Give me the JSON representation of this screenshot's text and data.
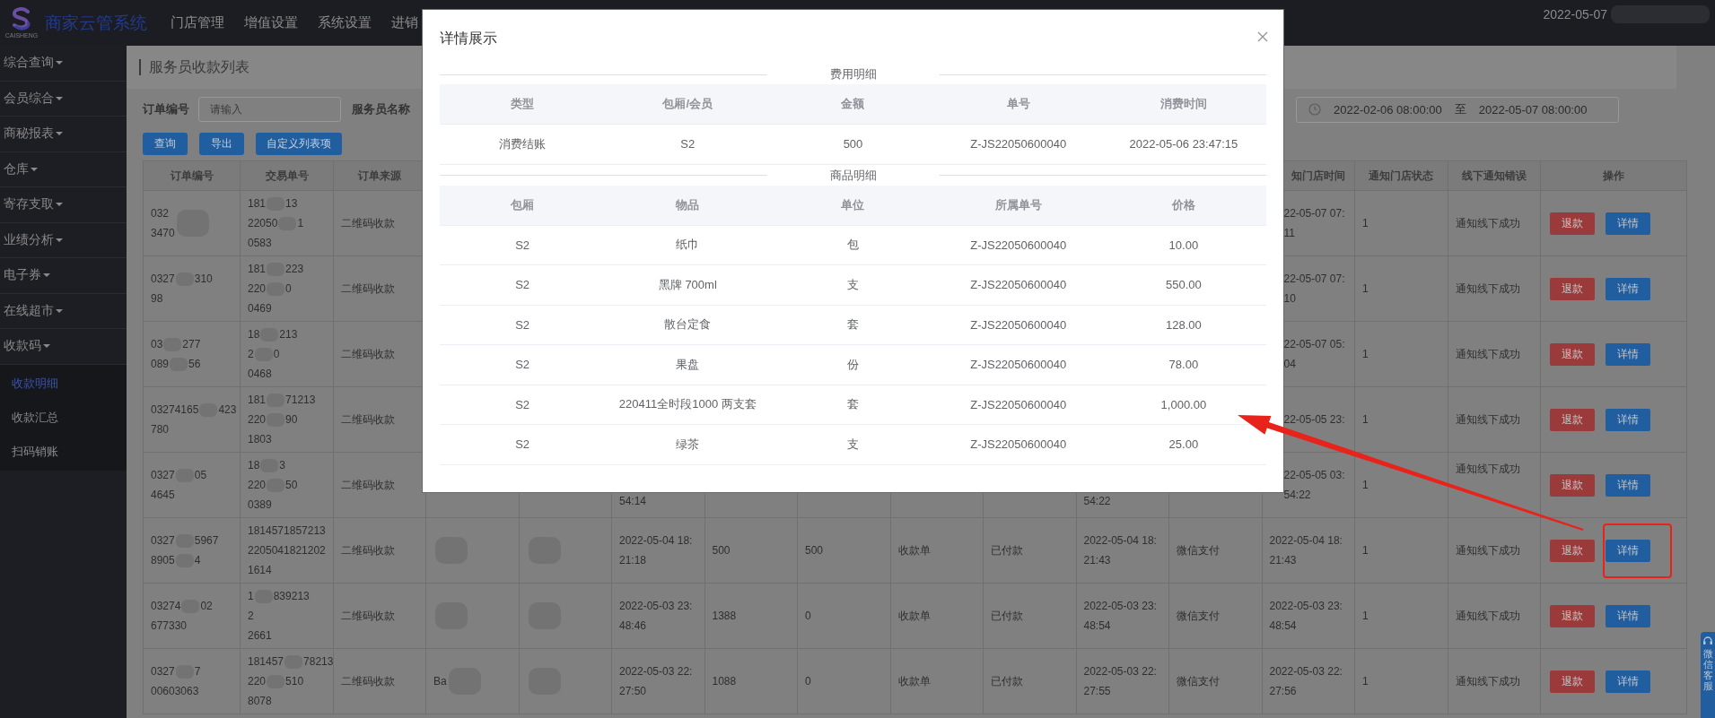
{
  "header": {
    "logo_text": "CAISHENG",
    "app_title": "商家云管系统",
    "nav": [
      "门店管理",
      "增值设置",
      "系统设置",
      "进销"
    ],
    "date": "2022-05-07"
  },
  "sidebar": {
    "items": [
      {
        "label": "综合查询"
      },
      {
        "label": "会员综合"
      },
      {
        "label": "商秘报表"
      },
      {
        "label": "仓库"
      },
      {
        "label": "寄存支取"
      },
      {
        "label": "业绩分析"
      },
      {
        "label": "电子券"
      },
      {
        "label": "在线超市"
      },
      {
        "label": "收款码",
        "children": [
          {
            "label": "收款明细",
            "selected": true
          },
          {
            "label": "收款汇总",
            "selected": false
          },
          {
            "label": "扫码销账",
            "selected": false
          }
        ]
      }
    ]
  },
  "page": {
    "title": "服务员收款列表",
    "filters": [
      {
        "label": "订单编号",
        "placeholder": "请输入"
      },
      {
        "label": "服务员名称"
      }
    ],
    "date_range": {
      "start": "2022-02-06 08:00:00",
      "separator": "至",
      "end": "2022-05-07 08:00:00"
    },
    "buttons": [
      "查询",
      "导出",
      "自定义列表项"
    ]
  },
  "table": {
    "columns": [
      {
        "label": "订单编号"
      },
      {
        "label": "交易单号"
      },
      {
        "label": "订单来源"
      },
      {},
      {},
      {},
      {},
      {},
      {},
      {},
      {},
      {},
      {
        "label": "知门店时间"
      },
      {
        "label": "通知门店状态"
      },
      {
        "label": "线下通知错误"
      },
      {
        "label": "操作"
      }
    ],
    "rows": [
      {
        "highlighted": false,
        "actions": [
          "退款",
          "详情"
        ],
        "cells": [
          {
            "lines": [
              [
                "032"
              ],
              [
                "3470"
              ]
            ],
            "redacted": true
          },
          {
            "lines": [
              [
                "181",
                "13"
              ],
              [
                "22050",
                "1"
              ],
              [
                "0583"
              ]
            ]
          },
          "二维码收款",
          null,
          null,
          null,
          null,
          null,
          null,
          null,
          null,
          null,
          {
            "lines": [
              [
                "22-05-07 07:"
              ],
              [
                "11"
              ]
            ]
          },
          "1",
          "通知线下成功"
        ]
      },
      {
        "highlighted": false,
        "actions": [
          "退款",
          "详情"
        ],
        "cells": [
          {
            "lines": [
              [
                "0327",
                "310"
              ],
              [
                "98"
              ]
            ]
          },
          {
            "lines": [
              [
                "181",
                "223"
              ],
              [
                "220",
                "0"
              ],
              [
                "0469"
              ]
            ]
          },
          "二维码收款",
          null,
          null,
          null,
          null,
          null,
          null,
          null,
          null,
          null,
          {
            "lines": [
              [
                "22-05-07 07:"
              ],
              [
                "10"
              ]
            ]
          },
          "1",
          "通知线下成功"
        ]
      },
      {
        "highlighted": false,
        "actions": [
          "退款",
          "详情"
        ],
        "cells": [
          {
            "lines": [
              [
                "03",
                "277"
              ],
              [
                "089",
                "56"
              ]
            ]
          },
          {
            "lines": [
              [
                "18",
                "213"
              ],
              [
                "2",
                "0"
              ],
              [
                "0468"
              ]
            ]
          },
          "二维码收款",
          null,
          null,
          null,
          null,
          null,
          null,
          null,
          null,
          null,
          {
            "lines": [
              [
                "22-05-07 05:"
              ],
              [
                "04"
              ]
            ]
          },
          "1",
          "通知线下成功"
        ]
      },
      {
        "highlighted": false,
        "actions": [
          "退款",
          "详情"
        ],
        "cells": [
          {
            "lines": [
              [
                "03274165",
                "423"
              ],
              [
                "780"
              ]
            ]
          },
          {
            "lines": [
              [
                "181",
                "71213"
              ],
              [
                "220",
                "90"
              ],
              [
                "1803"
              ]
            ]
          },
          "二维码收款",
          null,
          null,
          null,
          null,
          null,
          null,
          null,
          null,
          null,
          {
            "lines": [
              [
                "22-05-05 23:"
              ]
            ]
          },
          "1",
          "通知线下成功"
        ]
      },
      {
        "highlighted": false,
        "actions": [
          "退款",
          "详情"
        ],
        "cells": [
          {
            "lines": [
              [
                "0327",
                "05"
              ],
              [
                "4645"
              ]
            ]
          },
          {
            "lines": [
              [
                "18",
                "3"
              ],
              [
                "220",
                "50"
              ],
              [
                "0389"
              ]
            ]
          },
          "二维码收款",
          null,
          null,
          {
            "lines": [
              [
                "54:14"
              ]
            ]
          },
          null,
          null,
          null,
          null,
          {
            "lines": [
              [
                "54:22"
              ]
            ]
          },
          null,
          {
            "lines": [
              [
                "22-05-05 03:"
              ],
              [
                "54:22"
              ]
            ]
          },
          "1",
          "通知线下成功"
        ]
      },
      {
        "highlighted": true,
        "actions": [
          "退款",
          "详情"
        ],
        "cells": [
          {
            "lines": [
              [
                "0327",
                "5967"
              ],
              [
                "8905",
                "4"
              ]
            ]
          },
          {
            "lines": [
              [
                "1814571857213"
              ],
              [
                "2205041821202"
              ],
              [
                "1614"
              ]
            ]
          },
          "二维码收款",
          {
            "redacted": true
          },
          {
            "redacted": true
          },
          {
            "lines": [
              [
                "2022-05-04 18:"
              ],
              [
                "21:18"
              ]
            ]
          },
          "500",
          "500",
          "收款单",
          "已付款",
          {
            "lines": [
              [
                "2022-05-04 18:"
              ],
              [
                "21:43"
              ]
            ]
          },
          "微信支付",
          {
            "lines": [
              [
                "2022-05-04 18:"
              ],
              [
                "21:43"
              ]
            ]
          },
          "1",
          "通知线下成功"
        ]
      },
      {
        "highlighted": false,
        "actions": [
          "退款",
          "详情"
        ],
        "cells": [
          {
            "lines": [
              [
                "03274",
                "02"
              ],
              [
                "677330"
              ]
            ]
          },
          {
            "lines": [
              [
                "1",
                "839213"
              ],
              [
                "2"
              ],
              [
                "2661"
              ]
            ]
          },
          "二维码收款",
          {
            "redacted": true
          },
          {
            "redacted": true
          },
          {
            "lines": [
              [
                "2022-05-03 23:"
              ],
              [
                "48:46"
              ]
            ]
          },
          "1388",
          "0",
          "收款单",
          "已付款",
          {
            "lines": [
              [
                "2022-05-03 23:"
              ],
              [
                "48:54"
              ]
            ]
          },
          "微信支付",
          {
            "lines": [
              [
                "2022-05-03 23:"
              ],
              [
                "48:54"
              ]
            ]
          },
          "1",
          "通知线下成功"
        ]
      },
      {
        "highlighted": false,
        "actions": [
          "退款",
          "详情"
        ],
        "cells": [
          {
            "lines": [
              [
                "0327",
                "7"
              ],
              [
                "00603063"
              ]
            ]
          },
          {
            "lines": [
              [
                "181457",
                "78213"
              ],
              [
                "220",
                "510"
              ],
              [
                "8078"
              ]
            ]
          },
          "二维码收款",
          {
            "lines": [
              [
                "Ba"
              ]
            ],
            "redacted": true
          },
          {
            "redacted": true
          },
          {
            "lines": [
              [
                "2022-05-03 22:"
              ],
              [
                "27:50"
              ]
            ]
          },
          "1088",
          "0",
          "收款单",
          "已付款",
          {
            "lines": [
              [
                "2022-05-03 22:"
              ],
              [
                "27:55"
              ]
            ]
          },
          "微信支付",
          {
            "lines": [
              [
                "2022-05-03 22:"
              ],
              [
                "27:56"
              ]
            ]
          },
          "1",
          "通知线下成功"
        ]
      }
    ]
  },
  "modal": {
    "title": "详情展示",
    "sections": [
      {
        "title": "费用明细",
        "columns": [
          "类型",
          "包厢/会员",
          "金额",
          "单号",
          "消费时间"
        ],
        "rows": [
          [
            "消费结账",
            "S2",
            "500",
            "Z-JS22050600040",
            "2022-05-06 23:47:15"
          ]
        ]
      },
      {
        "title": "商品明细",
        "columns": [
          "包厢",
          "物品",
          "单位",
          "所属单号",
          "价格"
        ],
        "rows": [
          [
            "S2",
            "纸巾",
            "包",
            "Z-JS22050600040",
            "10.00"
          ],
          [
            "S2",
            "黑牌 700ml",
            "支",
            "Z-JS22050600040",
            "550.00"
          ],
          [
            "S2",
            "散台定食",
            "套",
            "Z-JS22050600040",
            "128.00"
          ],
          [
            "S2",
            "果盘",
            "份",
            "Z-JS22050600040",
            "78.00"
          ],
          [
            "S2",
            "220411全时段1000 两支套",
            "套",
            "Z-JS22050600040",
            "1,000.00"
          ],
          [
            "S2",
            "绿茶",
            "支",
            "Z-JS22050600040",
            "25.00"
          ]
        ]
      }
    ]
  },
  "side_tab": {
    "label": "微信客服"
  }
}
